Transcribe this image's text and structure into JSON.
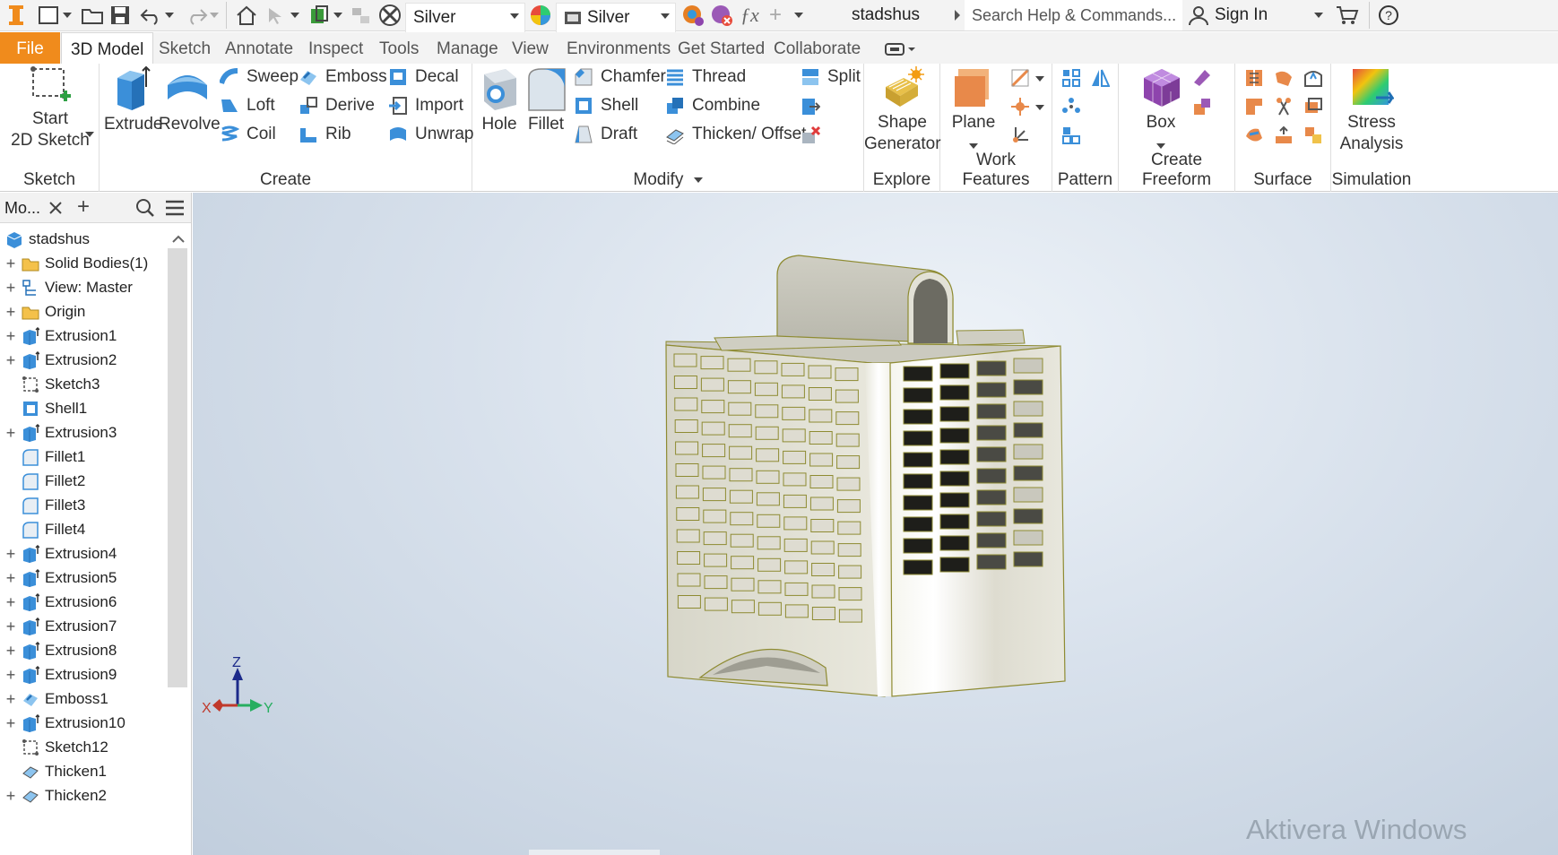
{
  "qat": {
    "material": "Silver",
    "appearance": "Silver",
    "doc_title": "stadshus",
    "search_placeholder": "Search Help & Commands...",
    "sign_in": "Sign In"
  },
  "tabs": [
    "File",
    "3D Model",
    "Sketch",
    "Annotate",
    "Inspect",
    "Tools",
    "Manage",
    "View",
    "Environments",
    "Get Started",
    "Collaborate"
  ],
  "ribbon": {
    "sketch": {
      "start": "Start",
      "sketch2d": "2D Sketch",
      "title": "Sketch"
    },
    "create": {
      "extrude": "Extrude",
      "revolve": "Revolve",
      "sweep": "Sweep",
      "loft": "Loft",
      "coil": "Coil",
      "emboss": "Emboss",
      "derive": "Derive",
      "rib": "Rib",
      "decal": "Decal",
      "import": "Import",
      "unwrap": "Unwrap",
      "title": "Create"
    },
    "modify": {
      "hole": "Hole",
      "fillet": "Fillet",
      "chamfer": "Chamfer",
      "shell": "Shell",
      "draft": "Draft",
      "thread": "Thread",
      "combine": "Combine",
      "thicken": "Thicken/ Offset",
      "split": "Split",
      "title": "Modify"
    },
    "explore": {
      "shape": "Shape",
      "generator": "Generator",
      "title": "Explore"
    },
    "work": {
      "plane": "Plane",
      "title": "Work Features"
    },
    "pattern": {
      "title": "Pattern"
    },
    "freeform": {
      "box": "Box",
      "title": "Create Freeform"
    },
    "surface": {
      "title": "Surface"
    },
    "simulation": {
      "stress": "Stress",
      "analysis": "Analysis",
      "title": "Simulation"
    }
  },
  "browser": {
    "tab": "Mo...",
    "root": "stadshus",
    "items": [
      {
        "label": "Solid Bodies(1)",
        "icon": "folder-icon",
        "expand": true
      },
      {
        "label": "View: Master",
        "icon": "view-icon",
        "expand": true
      },
      {
        "label": "Origin",
        "icon": "folder-icon",
        "expand": true
      },
      {
        "label": "Extrusion1",
        "icon": "extrude-icon",
        "expand": true
      },
      {
        "label": "Extrusion2",
        "icon": "extrude-icon",
        "expand": true
      },
      {
        "label": "Sketch3",
        "icon": "sketch-icon",
        "expand": false
      },
      {
        "label": "Shell1",
        "icon": "shell-icon",
        "expand": false
      },
      {
        "label": "Extrusion3",
        "icon": "extrude-icon",
        "expand": true
      },
      {
        "label": "Fillet1",
        "icon": "fillet-icon",
        "expand": false
      },
      {
        "label": "Fillet2",
        "icon": "fillet-icon",
        "expand": false
      },
      {
        "label": "Fillet3",
        "icon": "fillet-icon",
        "expand": false
      },
      {
        "label": "Fillet4",
        "icon": "fillet-icon",
        "expand": false
      },
      {
        "label": "Extrusion4",
        "icon": "extrude-icon",
        "expand": true
      },
      {
        "label": "Extrusion5",
        "icon": "extrude-icon",
        "expand": true
      },
      {
        "label": "Extrusion6",
        "icon": "extrude-icon",
        "expand": true
      },
      {
        "label": "Extrusion7",
        "icon": "extrude-icon",
        "expand": true
      },
      {
        "label": "Extrusion8",
        "icon": "extrude-icon",
        "expand": true
      },
      {
        "label": "Extrusion9",
        "icon": "extrude-icon",
        "expand": true
      },
      {
        "label": "Emboss1",
        "icon": "emboss-icon",
        "expand": true
      },
      {
        "label": "Extrusion10",
        "icon": "extrude-icon",
        "expand": true
      },
      {
        "label": "Sketch12",
        "icon": "sketch-icon",
        "expand": false
      },
      {
        "label": "Thicken1",
        "icon": "thicken-icon",
        "expand": false
      },
      {
        "label": "Thicken2",
        "icon": "thicken-icon",
        "expand": true
      }
    ]
  },
  "viewport": {
    "axes": {
      "x": "X",
      "y": "Y",
      "z": "Z"
    },
    "watermark": "Aktivera Windows"
  }
}
